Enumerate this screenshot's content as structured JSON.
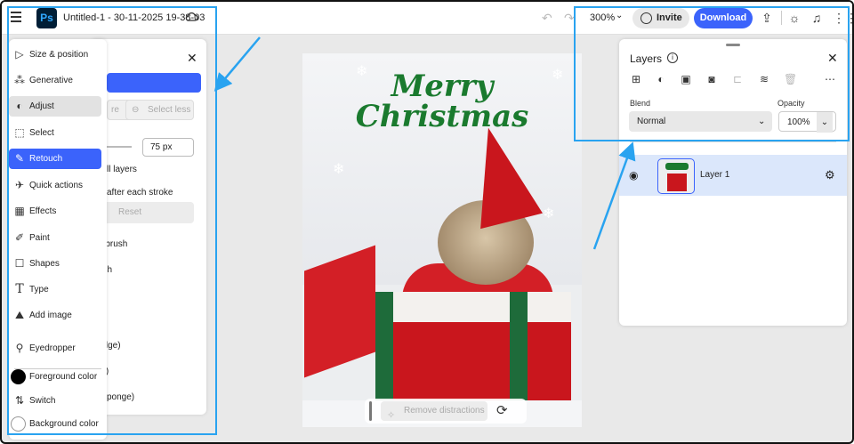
{
  "header": {
    "app_logo": "Ps",
    "doc_title": "Untitled-1 - 30-11-2025 19-38-03",
    "zoom": "300%",
    "invite_label": "Invite",
    "download_label": "Download"
  },
  "tools": {
    "items": [
      {
        "label": "Size & position",
        "icon": "cursor-icon"
      },
      {
        "label": "Generative",
        "icon": "generative-icon"
      },
      {
        "label": "Adjust",
        "icon": "adjust-icon"
      },
      {
        "label": "Select",
        "icon": "select-icon"
      },
      {
        "label": "Retouch",
        "icon": "retouch-icon"
      },
      {
        "label": "Quick actions",
        "icon": "quick-actions-icon"
      },
      {
        "label": "Effects",
        "icon": "effects-icon"
      },
      {
        "label": "Paint",
        "icon": "brush-icon"
      },
      {
        "label": "Shapes",
        "icon": "shapes-icon"
      },
      {
        "label": "Type",
        "icon": "type-icon"
      },
      {
        "label": "Add image",
        "icon": "add-image-icon"
      }
    ],
    "eyedropper": "Eyedropper",
    "foreground": "Foreground color",
    "switch": "Switch",
    "background": "Background color"
  },
  "options": {
    "btn_fragment": "re",
    "select_less": "Select less",
    "size_value": "75 px",
    "all_layers": "ll layers",
    "after_stroke": "after each stroke",
    "reset": "Reset",
    "item1": "g brush",
    "item2": "ush",
    "item3": "p",
    "item4": "odge)",
    "item5": "rn)",
    "item6": "(Sponge)"
  },
  "canvas": {
    "headline_1": "Merry",
    "headline_2": "Christmas",
    "remove_label": "Remove distractions"
  },
  "layers": {
    "title": "Layers",
    "blend_label": "Blend",
    "blend_value": "Normal",
    "opacity_label": "Opacity",
    "opacity_value": "100%",
    "layer_name": "Layer 1"
  },
  "colors": {
    "accent": "#3b63fb",
    "highlight": "#29a3f0",
    "foreground": "#000000",
    "background": "#ffffff"
  }
}
